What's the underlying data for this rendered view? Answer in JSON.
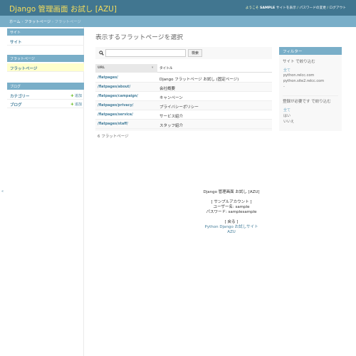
{
  "header": {
    "site_title": "Django 管理画面 お試し [AZU]",
    "welcome": "ようこそ",
    "username": "SAMPLE",
    "view_site": "サイトを表示",
    "change_password": "パスワードの変更",
    "logout": "ログアウト",
    "separator": " / "
  },
  "breadcrumbs": {
    "home": "ホーム",
    "section": "フラットページ",
    "current": "フラットページ",
    "separator": " › "
  },
  "sidebar": {
    "toggle": "«",
    "modules": [
      {
        "caption": "サイト",
        "items": [
          {
            "label": "サイト"
          }
        ]
      },
      {
        "caption": "フラットページ",
        "items": [
          {
            "label": "フラットページ",
            "current": true
          }
        ]
      },
      {
        "caption": "ブログ",
        "items": [
          {
            "label": "カテゴリー",
            "add": "追加"
          },
          {
            "label": "ブログ",
            "add": "追加"
          }
        ]
      }
    ]
  },
  "content": {
    "title": "表示するフラットページを選択",
    "search": {
      "button": "検索",
      "value": ""
    },
    "columns": {
      "url": "URL",
      "title": "タイトル"
    },
    "rows": [
      {
        "url": "/flatpages/",
        "title": "Django フラットページ お試し (固定ページ)"
      },
      {
        "url": "/flatpages/about/",
        "title": "会社概要"
      },
      {
        "url": "/flatpages/campaign/",
        "title": "キャンペーン"
      },
      {
        "url": "/flatpages/privacy/",
        "title": "プライバシーポリシー"
      },
      {
        "url": "/flatpages/service/",
        "title": "サービス紹介"
      },
      {
        "url": "/flatpages/staff/",
        "title": "スタッフ紹介"
      }
    ],
    "paginator": "6 フラットページ"
  },
  "filter": {
    "heading": "フィルター",
    "groups": [
      {
        "title": "サイト で絞り込む",
        "items": [
          "全て",
          "python.relcc.com",
          "python.site2.relcc.com",
          "-"
        ]
      },
      {
        "title": "登録が必要です で絞り込む",
        "items": [
          "全て",
          "はい",
          "いいえ"
        ]
      }
    ]
  },
  "footer": {
    "line1": "Django 管理画面 お試し [AZU]",
    "line2": "[ サンプルアカウント ]",
    "line3": "ユーザー名: sample",
    "line4": "パスワード: samplesample",
    "line5": "[ 戻る ]",
    "link1": "Python Django お試しサイト",
    "link2": "AZU"
  }
}
